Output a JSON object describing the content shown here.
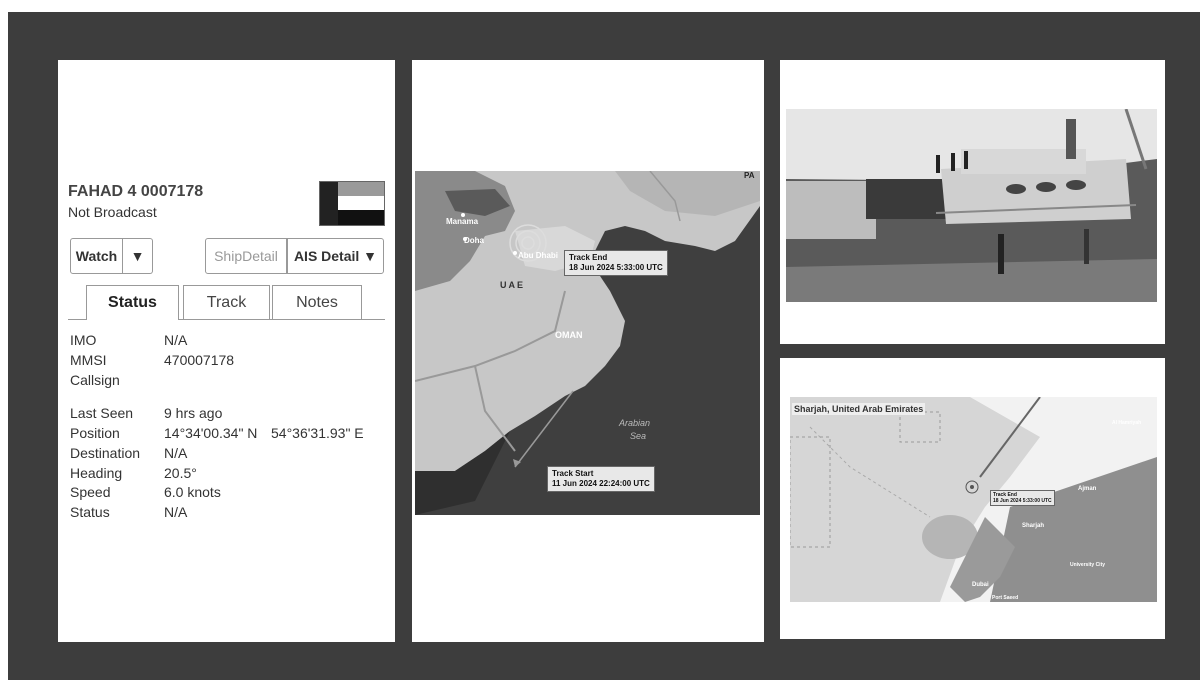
{
  "vessel": {
    "name": "FAHAD 4 0007178",
    "broadcast": "Not Broadcast",
    "buttons": {
      "watch": "Watch",
      "dropdown": "▼",
      "ship_detail": "ShipDetail",
      "ais_detail": "AIS Detail ▼"
    },
    "tabs": [
      "Status",
      "Track",
      "Notes"
    ],
    "fields": [
      {
        "key": "IMO",
        "value": "N/A"
      },
      {
        "key": "MMSI",
        "value": "470007178"
      },
      {
        "key": "Callsign",
        "value": ""
      },
      {
        "key": "Last Seen",
        "value": "9 hrs ago"
      },
      {
        "key": "Position",
        "value": "14°34'00.34\" N",
        "value2": "54°36'31.93\" E"
      },
      {
        "key": "Destination",
        "value": "N/A"
      },
      {
        "key": "Heading",
        "value": "20.5°"
      },
      {
        "key": "Speed",
        "value": "6.0 knots"
      },
      {
        "key": "Status",
        "value": "N/A"
      }
    ],
    "flag_colors": {
      "hoist": "#222222",
      "top": "#9a9a9a",
      "middle": "#ffffff",
      "bottom": "#111111"
    }
  },
  "region_map": {
    "labels": {
      "manama": "Manama",
      "doha": "Doha",
      "abudhabi": "Abu Dhabi",
      "uae": "UAE",
      "oman": "OMAN",
      "sea1": "Arabian",
      "sea2": "Sea",
      "corner": "PA"
    },
    "track_end": {
      "title": "Track End",
      "time": "18 Jun 2024 5:33:00 UTC"
    },
    "track_start": {
      "title": "Track Start",
      "time": "11 Jun 2024 22:24:00 UTC"
    }
  },
  "port_map": {
    "location": "Sharjah, United Arab Emirates",
    "track_end": {
      "title": "Track End",
      "time": "18 Jun 2024 5:33:00 UTC"
    },
    "labels": {
      "sharjah": "Sharjah",
      "ajman": "Ajman",
      "al_hamriyah": "Al Hamriyah",
      "university_city": "University City",
      "port_saeed": "Port Saeed",
      "dubai": "Dubai"
    }
  }
}
